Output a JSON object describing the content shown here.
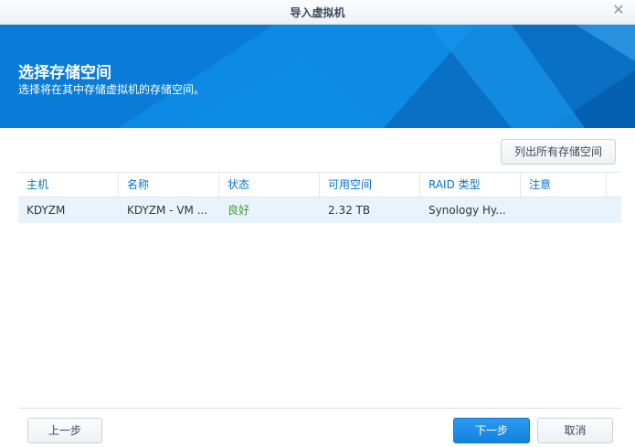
{
  "window": {
    "title": "导入虚拟机",
    "close_icon": "close-icon"
  },
  "banner": {
    "title": "选择存储空间",
    "subtitle": "选择将在其中存储虚拟机的存储空间。",
    "colors": {
      "primary": "#0b86e0",
      "dark": "#0868c0",
      "light": "#3aa6f2"
    }
  },
  "toolbar": {
    "list_all_label": "列出所有存储空间"
  },
  "table": {
    "columns": [
      "主机",
      "名称",
      "状态",
      "可用空间",
      "RAID 类型",
      "注意"
    ],
    "rows": [
      {
        "host": "KDYZM",
        "name": "KDYZM - VM ...",
        "status": "良好",
        "free_space": "2.32 TB",
        "raid_type": "Synology Hy...",
        "note": ""
      }
    ],
    "status_good_color": "#3f9a2c",
    "selected_row_color": "#e9f3fd"
  },
  "footer": {
    "prev_label": "上一步",
    "next_label": "下一步",
    "cancel_label": "取消"
  }
}
